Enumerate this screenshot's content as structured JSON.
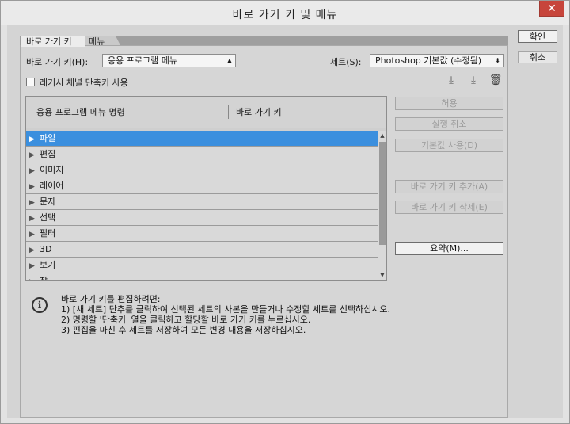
{
  "window": {
    "title": "바로 가기 키 및 메뉴",
    "close": "✕"
  },
  "tabs": {
    "active": "바로 가기 키",
    "inactive": "메뉴"
  },
  "shortcuts_for": {
    "label": "바로 가기 키(H):",
    "value": "응용 프로그램 메뉴"
  },
  "set": {
    "label": "세트(S):",
    "value": "Photoshop 기본값 (수정됨)"
  },
  "legacy": {
    "label": "레거시 채널 단축키 사용",
    "checked": false
  },
  "table": {
    "col_command": "응용 프로그램 메뉴 명령",
    "col_shortcut": "바로 가기 키",
    "rows": [
      "파일",
      "편집",
      "이미지",
      "레이어",
      "문자",
      "선택",
      "필터",
      "3D",
      "보기",
      "창"
    ],
    "selected_index": 0
  },
  "side_buttons": {
    "accept": "허용",
    "undo": "실행 취소",
    "use_default": "기본값 사용(D)",
    "add_shortcut": "바로 가기 키 추가(A)",
    "delete_shortcut": "바로 가기 키 삭제(E)",
    "summarize": "요약(M)..."
  },
  "dialog_buttons": {
    "ok": "확인",
    "cancel": "취소"
  },
  "info": {
    "heading": "바로 가기 키를 편집하려면:",
    "line1": "1) [새 세트] 단추를 클릭하여 선택된 세트의 사본을 만들거나 수정할 세트를 선택하십시오.",
    "line2": "2) 명령할 '단축키' 열을 클릭하고 할당할 바로 가기 키를 누르십시오.",
    "line3": "3) 편집을 마친 후 세트를 저장하여 모든 변경 내용을 저장하십시오."
  },
  "icons": [
    "save-set-icon",
    "save-as-set-icon",
    "delete-set-icon",
    "info-icon"
  ]
}
